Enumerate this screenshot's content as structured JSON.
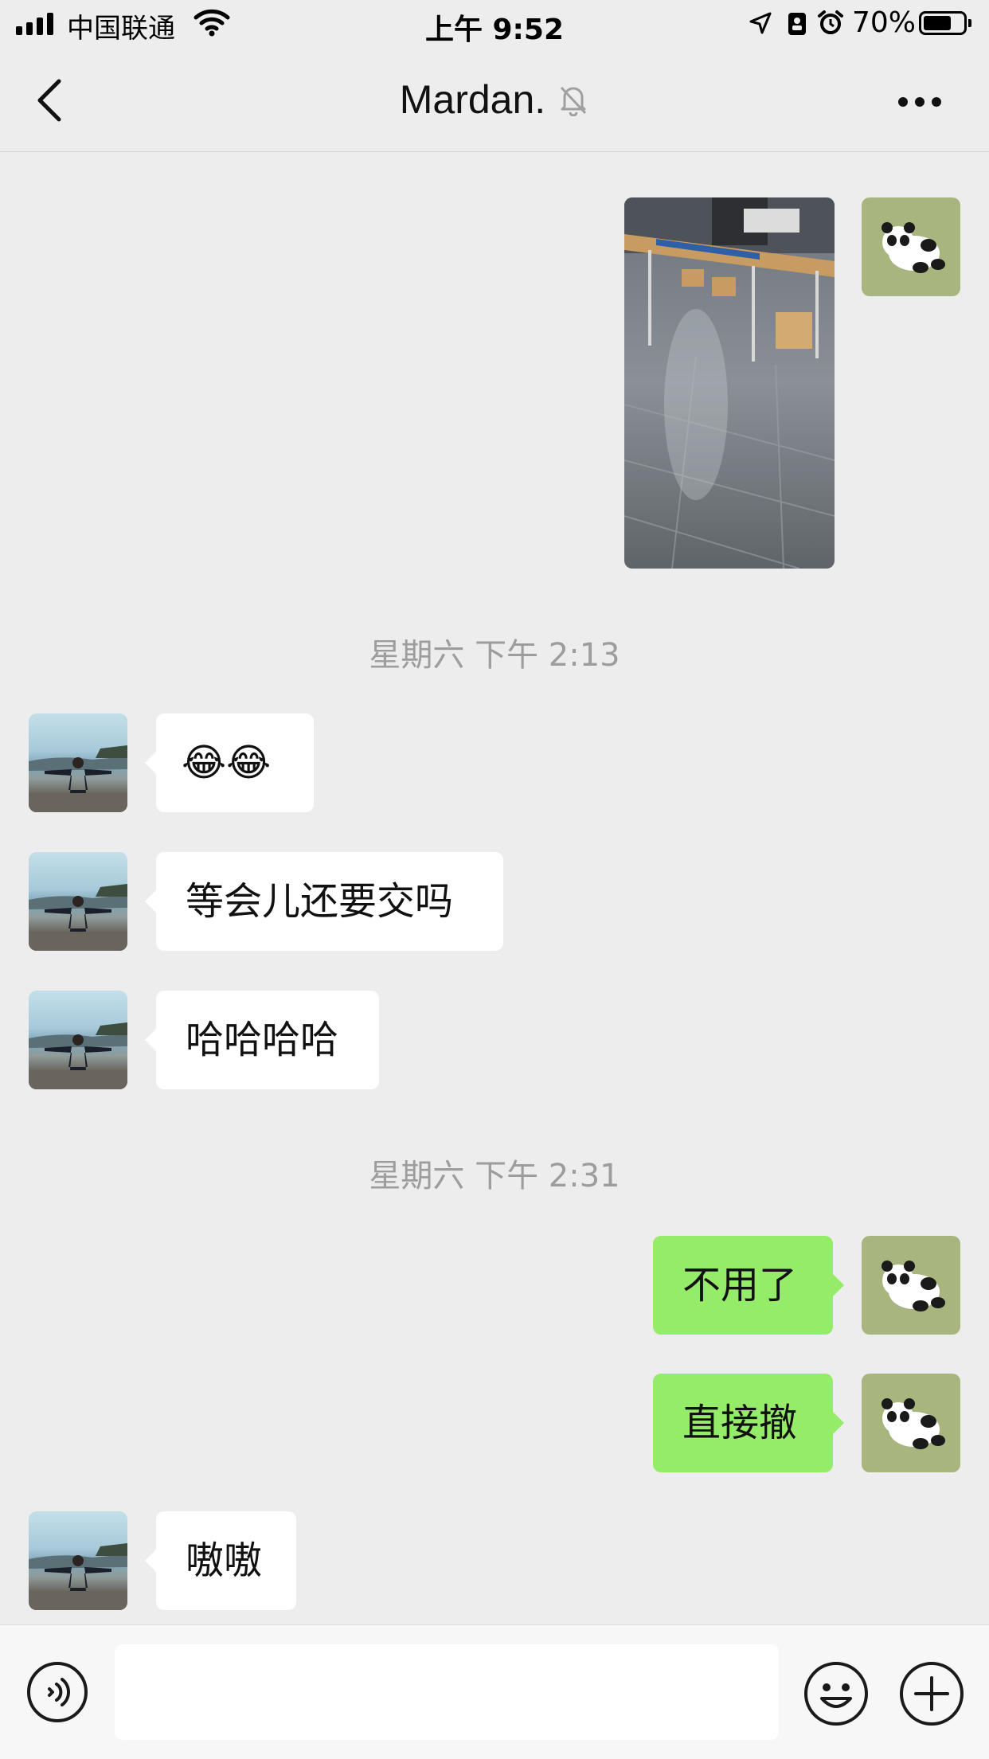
{
  "status_bar": {
    "carrier": "中国联通",
    "time": "上午 9:52",
    "battery_percent_text": "70%",
    "battery_level": 0.7,
    "icons": [
      "signal-icon",
      "wifi-icon",
      "location-icon",
      "portrait-lock-icon",
      "alarm-icon",
      "battery-icon"
    ]
  },
  "header": {
    "title": "Mardan.",
    "muted_icon": "bell-muted-icon",
    "back_icon": "chevron-left-icon",
    "more_icon": "more-icon"
  },
  "messages": [
    {
      "direction": "out",
      "type": "image",
      "image_icon": "photo-hallway-table"
    },
    {
      "type": "timestamp",
      "text": "星期六 下午 2:13"
    },
    {
      "direction": "in",
      "type": "emoji",
      "text": "😂😂"
    },
    {
      "direction": "in",
      "type": "text",
      "text": "等会儿还要交吗"
    },
    {
      "direction": "in",
      "type": "text",
      "text": "哈哈哈哈"
    },
    {
      "type": "timestamp",
      "text": "星期六 下午 2:31"
    },
    {
      "direction": "out",
      "type": "text",
      "text": "不用了"
    },
    {
      "direction": "out",
      "type": "text",
      "text": "直接撤"
    },
    {
      "direction": "in",
      "type": "text",
      "text": "嗷嗷"
    }
  ],
  "colors": {
    "background": "#ededed",
    "outgoing_bubble": "#95ec69",
    "incoming_bubble": "#ffffff",
    "timestamp_text": "#9d9d9d"
  },
  "input_bar": {
    "placeholder": "",
    "icons": [
      "voice-icon",
      "emoji-icon",
      "plus-icon"
    ]
  }
}
